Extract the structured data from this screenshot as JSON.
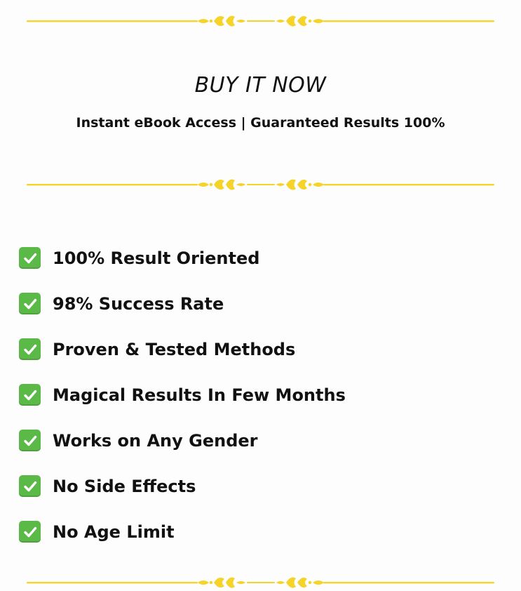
{
  "colors": {
    "accent_gold": "#f5d328",
    "check_green": "#5bb947",
    "text": "#111111",
    "background": "#fdfdfd"
  },
  "header": {
    "title": "BUY IT NOW",
    "subtitle": "Instant eBook Access | Guaranteed Results 100%"
  },
  "dividers": {
    "icon": "ornamental-gold-divider"
  },
  "features": {
    "icon": "green-checkmark-icon",
    "items": [
      {
        "label": "100% Result Oriented"
      },
      {
        "label": "98% Success Rate"
      },
      {
        "label": "Proven & Tested Methods"
      },
      {
        "label": "Magical Results In Few Months"
      },
      {
        "label": "Works on Any Gender"
      },
      {
        "label": "No Side Effects"
      },
      {
        "label": "No Age Limit"
      }
    ]
  }
}
